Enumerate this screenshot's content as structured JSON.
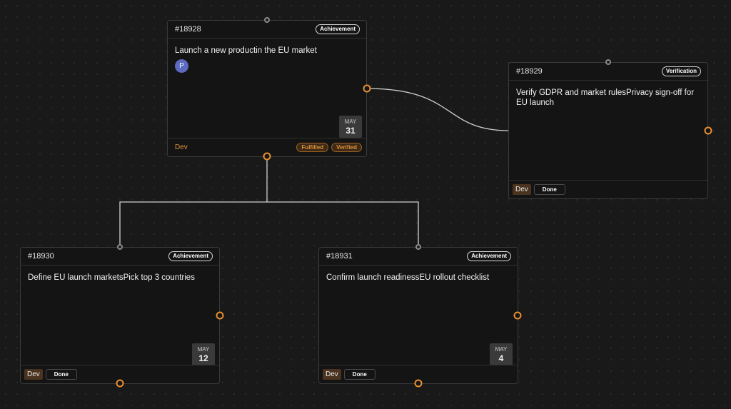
{
  "nodes": {
    "n18928": {
      "id": "#18928",
      "type": "Achievement",
      "title": "Launch a new productin the EU market",
      "avatar_initial": "P",
      "due": {
        "month": "MAY",
        "day": "31"
      },
      "team": "Dev",
      "badges": [
        "Fulfilled",
        "Verified"
      ]
    },
    "n18929": {
      "id": "#18929",
      "type": "Verification",
      "title": "Verify GDPR and market rulesPrivacy sign-off for EU launch",
      "team": "Dev",
      "status": "Done"
    },
    "n18930": {
      "id": "#18930",
      "type": "Achievement",
      "title": "Define EU launch marketsPick top 3 countries",
      "due": {
        "month": "MAY",
        "day": "12"
      },
      "team": "Dev",
      "status": "Done"
    },
    "n18931": {
      "id": "#18931",
      "type": "Achievement",
      "title": "Confirm launch readinessEU rollout checklist",
      "due": {
        "month": "MAY",
        "day": "4"
      },
      "team": "Dev",
      "status": "Done"
    }
  },
  "colors": {
    "canvas": "#191919",
    "card": "#141414",
    "accent_orange": "#e8902e",
    "edge": "#d0d0d0",
    "port_gray": "#8a8a8a"
  }
}
